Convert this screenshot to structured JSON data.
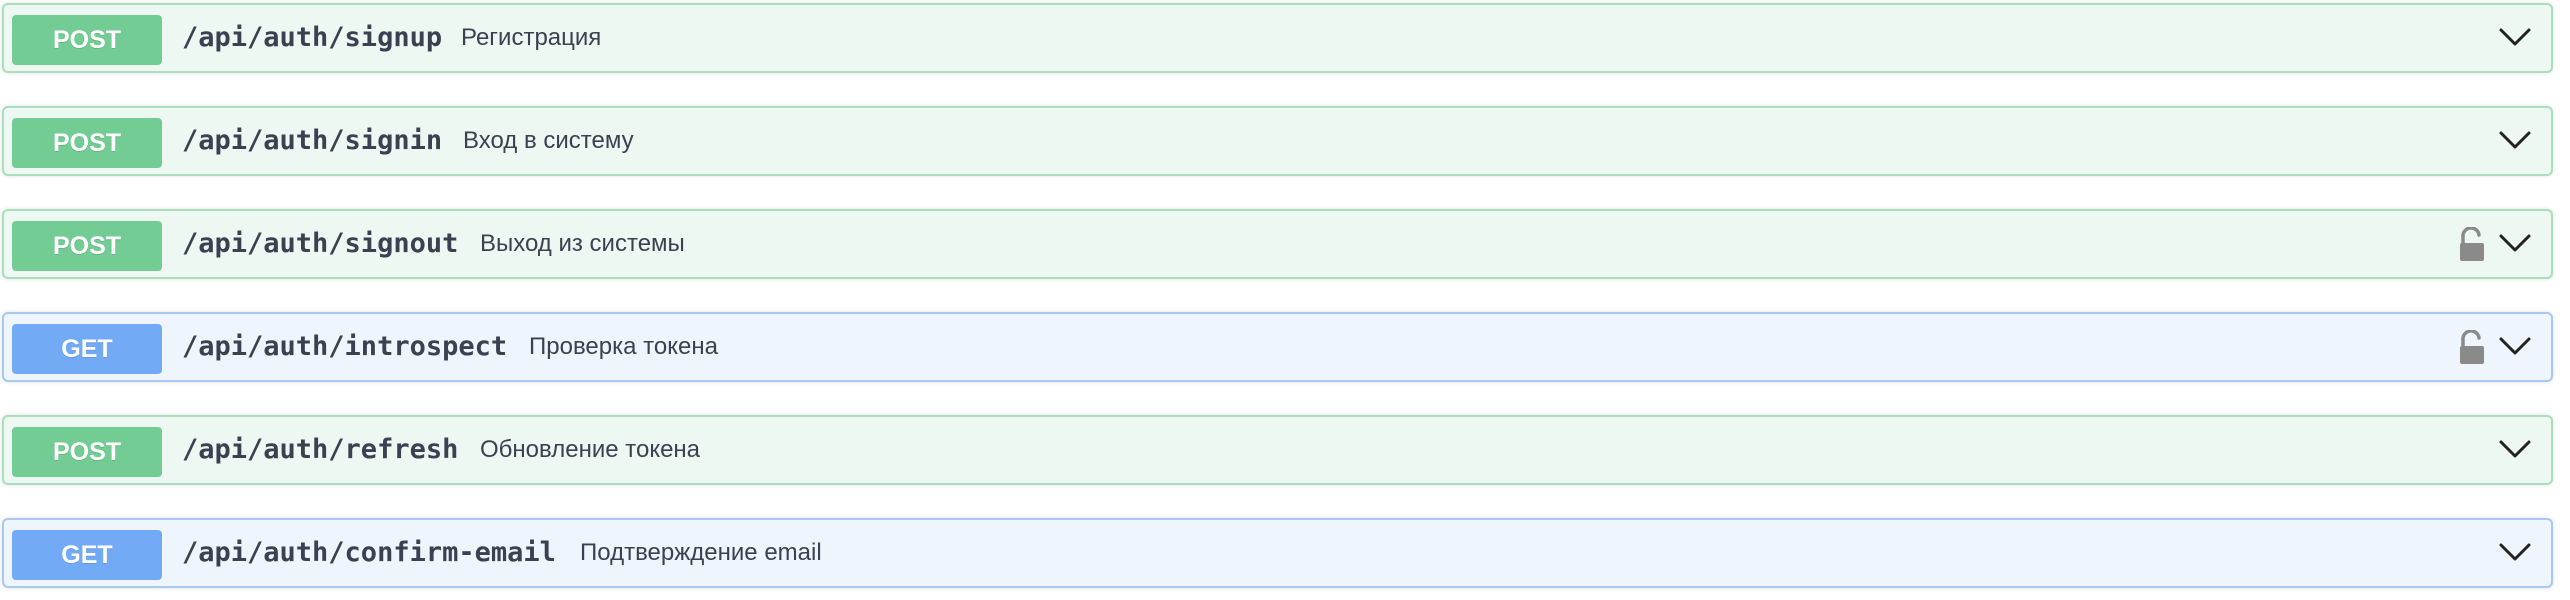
{
  "operations": [
    {
      "method": "POST",
      "path": "/api/auth/signup",
      "summary": "Регистрация",
      "locked": false
    },
    {
      "method": "POST",
      "path": "/api/auth/signin",
      "summary": "Вход в систему",
      "locked": false
    },
    {
      "method": "POST",
      "path": "/api/auth/signout",
      "summary": "Выход из системы",
      "locked": true
    },
    {
      "method": "GET",
      "path": "/api/auth/introspect",
      "summary": "Проверка токена",
      "locked": true
    },
    {
      "method": "POST",
      "path": "/api/auth/refresh",
      "summary": "Обновление токена",
      "locked": false
    },
    {
      "method": "GET",
      "path": "/api/auth/confirm-email",
      "summary": "Подтверждение email",
      "locked": false
    }
  ],
  "icons": {
    "lock": "unlocked-padlock-icon",
    "expand": "chevron-down-icon"
  },
  "colors": {
    "post_badge": "#72cc93",
    "post_bg": "#eef8f2",
    "post_border": "#a9dfbd",
    "get_badge": "#72aaf5",
    "get_bg": "#eef5fd",
    "get_border": "#a7c9f3",
    "text": "#3b4151",
    "icon": "#8a8a8a"
  }
}
